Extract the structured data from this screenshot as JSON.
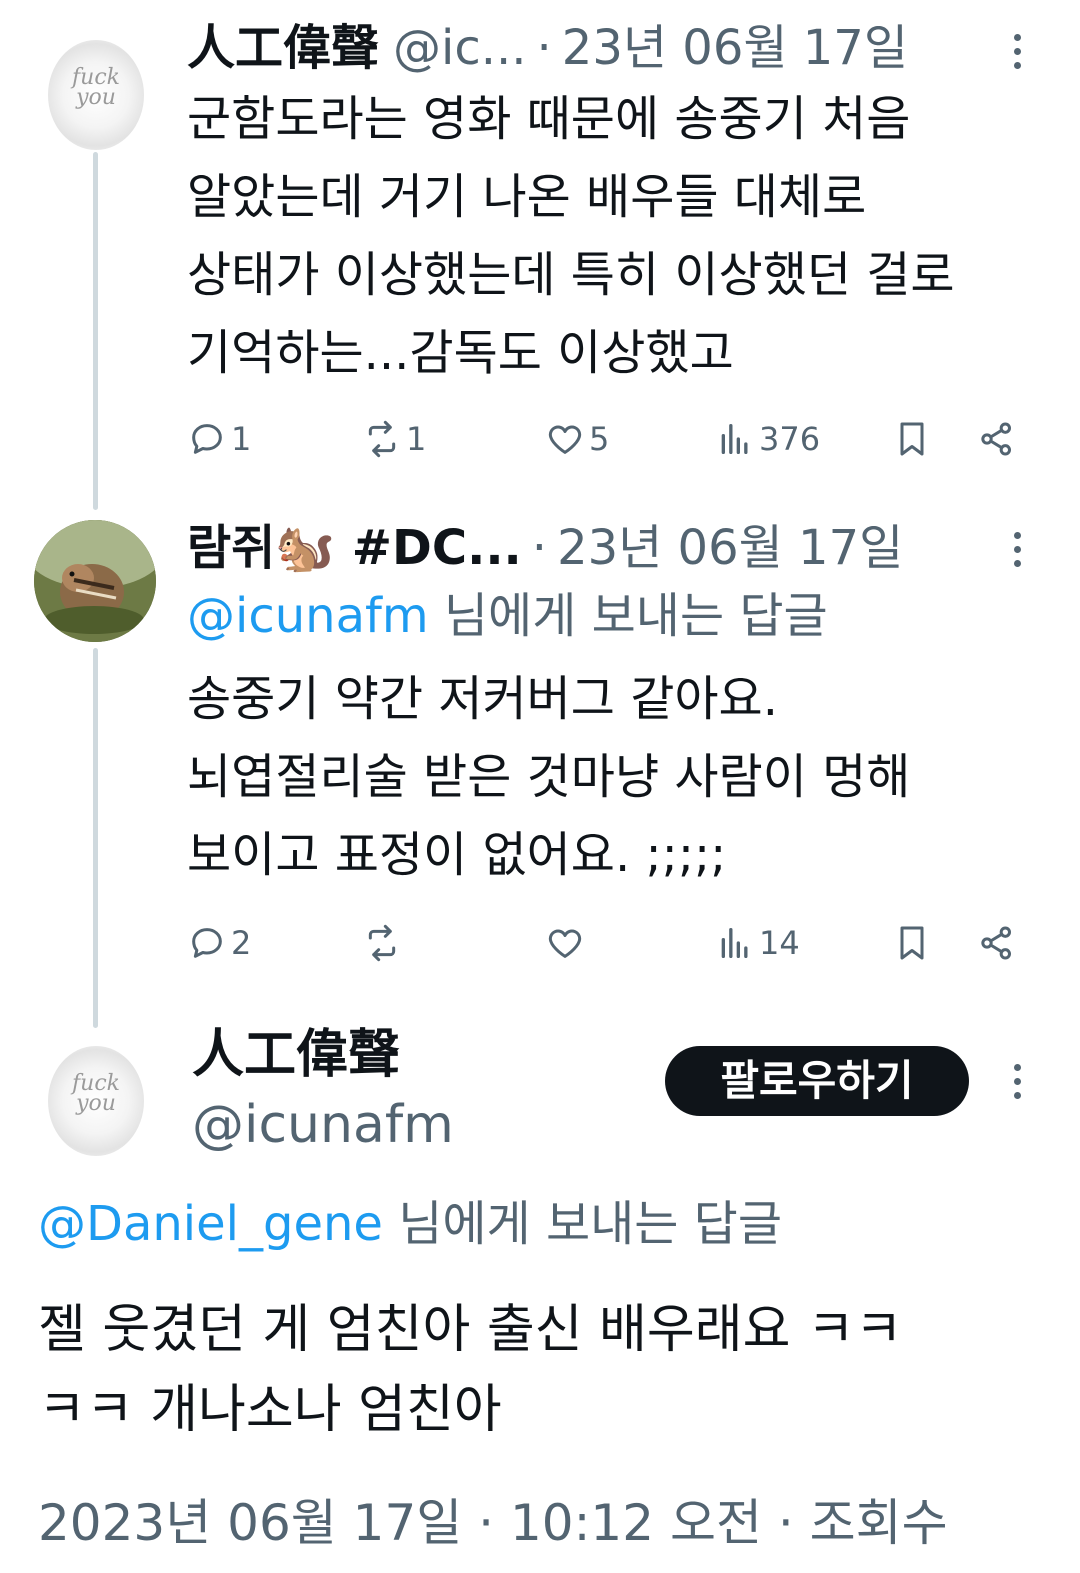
{
  "tweet1": {
    "name": "人工偉聲",
    "handle": "@ic...",
    "date": "23년 06월 17일",
    "lines": [
      "군함도라는 영화 때문에 송중기 처음",
      "알았는데 거기 나온 배우들 대체로",
      "상태가 이상했는데 특히 이상했던 걸로",
      "기억하는...감독도 이상했고"
    ],
    "replies": "1",
    "retweets": "1",
    "likes": "5",
    "views": "376"
  },
  "tweet2": {
    "name": "람쥐🐿️ #DC...",
    "date": "23년 06월 17일",
    "reply_to_mention": "@icunafm",
    "reply_to_suffix": " 님에게 보내는 답글",
    "lines": [
      "송중기 약간 저커버그 같아요.",
      "뇌엽절리술 받은 것마냥 사람이 멍해",
      "보이고 표정이 없어요. ;;;;;"
    ],
    "replies": "2",
    "retweets": "",
    "likes": "",
    "views": "14"
  },
  "main_tweet": {
    "name": "人工偉聲",
    "handle": "@icunafm",
    "follow_label": "팔로우하기",
    "reply_to_mention": "@Daniel_gene",
    "reply_to_suffix": " 님에게 보내는 답글",
    "lines": [
      "젤 웃겼던 게 엄친아 출신 배우래요 ㅋㅋ",
      "ㅋㅋ 개나소나 엄친아"
    ],
    "meta": "2023년 06월 17일 · 10:12 오전 · 조회수"
  },
  "avatar_ring_text": [
    "fuck",
    "you"
  ],
  "icons": {
    "reply": "reply-icon",
    "retweet": "retweet-icon",
    "like": "heart-icon",
    "views": "views-icon",
    "bookmark": "bookmark-icon",
    "share": "share-icon",
    "more": "more-icon"
  },
  "colors": {
    "text": "#0f1419",
    "secondary": "#536471",
    "link": "#1d9bf0",
    "thread_line": "#cfd9de",
    "follow_bg": "#0f1419"
  }
}
